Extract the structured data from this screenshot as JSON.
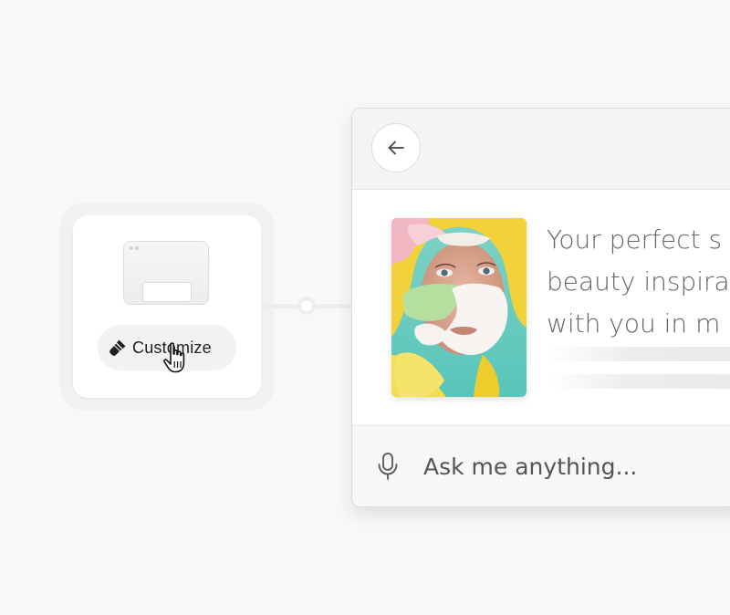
{
  "widget": {
    "customize_label": "Customize"
  },
  "chat": {
    "message_lines": [
      "Your perfect s",
      "beauty inspira",
      "with you in m"
    ],
    "input_placeholder": "Ask me anything..."
  },
  "icons": {
    "back": "arrow-left-icon",
    "mic": "microphone-icon",
    "brush": "paintbrush-icon",
    "cursor": "pointer-hand-icon"
  },
  "colors": {
    "background": "#f8f8f7",
    "text_primary": "#1f1f1f",
    "text_secondary": "#666666"
  }
}
